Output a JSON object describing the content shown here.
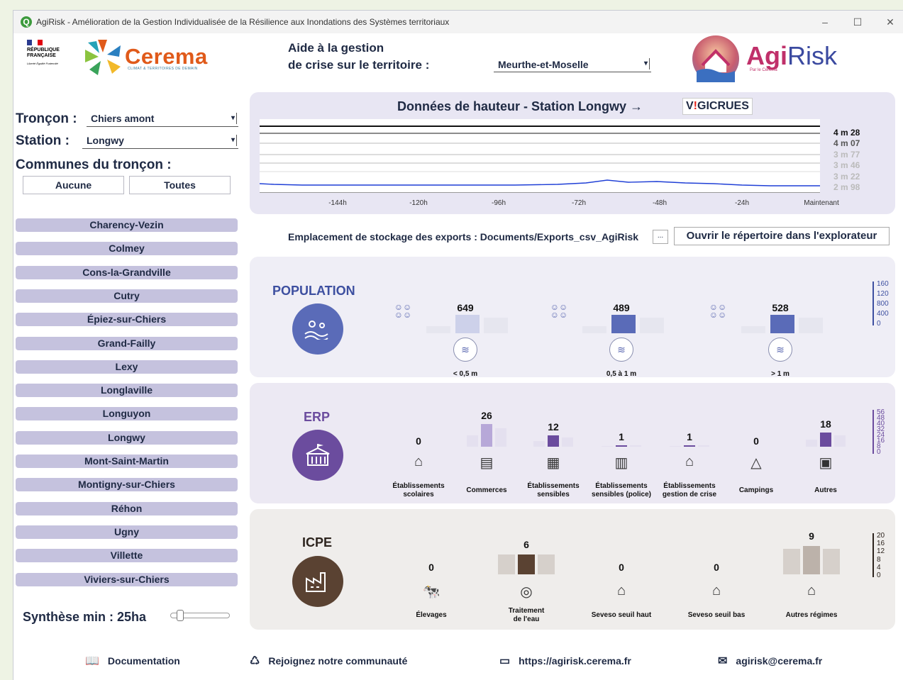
{
  "window": {
    "title": "AgiRisk - Amélioration de la Gestion Individualisée de la Résilience aux Inondations des Systèmes territoriaux",
    "minimize": "–",
    "maximize": "☐",
    "close": "✕"
  },
  "logos": {
    "rf": "RÉPUBLIQUE FRANÇAISE",
    "rf_motto": "Liberté Égalité Fraternité",
    "cerema": "Cerema",
    "cerema_sub": "CLIMAT & TERRITOIRES DE DEMAIN",
    "agirisk_a": "Agi",
    "agirisk_b": "Risk",
    "agirisk_sub": "Par le Cerema"
  },
  "header": {
    "aide_line1": "Aide à la gestion",
    "aide_line2": "de crise sur le territoire :",
    "departement": "Meurthe-et-Moselle"
  },
  "sidebar": {
    "troncon_label": "Tronçon :",
    "troncon_value": "Chiers amont",
    "station_label": "Station :",
    "station_value": "Longwy",
    "communes_label": "Communes du tronçon :",
    "btn_aucune": "Aucune",
    "btn_toutes": "Toutes",
    "communes": [
      "Charency-Vezin",
      "Colmey",
      "Cons-la-Grandville",
      "Cutry",
      "Épiez-sur-Chiers",
      "Grand-Failly",
      "Lexy",
      "Longlaville",
      "Longuyon",
      "Longwy",
      "Mont-Saint-Martin",
      "Montigny-sur-Chiers",
      "Réhon",
      "Ugny",
      "Villette",
      "Viviers-sur-Chiers"
    ],
    "synthese": "Synthèse min : 25ha"
  },
  "hydro": {
    "title": "Données de hauteur - Station Longwy →",
    "vigicrues_a": "V",
    "vigicrues_b": "!",
    "vigicrues_c": "GICRUES",
    "xticks": [
      "-144h",
      "-120h",
      "-96h",
      "-72h",
      "-48h",
      "-24h",
      "Maintenant"
    ],
    "levels": [
      "4 m 28",
      "4 m 07",
      "3 m 77",
      "3 m 46",
      "3 m 22",
      "2 m 98"
    ],
    "level_colors": [
      "#111111",
      "#555555",
      "#bbbbbb",
      "#bbbbbb",
      "#bbbbbb",
      "#bbbbbb"
    ],
    "series_color": "#1f3fd6"
  },
  "export": {
    "label": "Emplacement de stockage des exports : Documents/Exports_csv_AgiRisk",
    "dots": "...",
    "open_btn": "Ouvrir le répertoire dans l'explorateur"
  },
  "population": {
    "title": "POPULATION",
    "color": "#5a6bb8",
    "groups": [
      {
        "value": "649",
        "label": "< 0,5 m"
      },
      {
        "value": "489",
        "label": "0,5 à 1 m"
      },
      {
        "value": "528",
        "label": "> 1 m"
      }
    ],
    "scale": [
      "160",
      "120",
      "800",
      "400",
      "0"
    ]
  },
  "erp": {
    "title": "ERP",
    "color": "#6b4c9e",
    "items": [
      {
        "value": "0",
        "label1": "Établissements",
        "label2": "scolaires"
      },
      {
        "value": "26",
        "label1": "Commerces",
        "label2": ""
      },
      {
        "value": "12",
        "label1": "Établissements",
        "label2": "sensibles"
      },
      {
        "value": "1",
        "label1": "Établissements",
        "label2": "sensibles (police)"
      },
      {
        "value": "1",
        "label1": "Établissements",
        "label2": "gestion de crise"
      },
      {
        "value": "0",
        "label1": "Campings",
        "label2": ""
      },
      {
        "value": "18",
        "label1": "Autres",
        "label2": ""
      }
    ],
    "scale": [
      "56",
      "48",
      "40",
      "32",
      "24",
      "16",
      "8",
      "0"
    ]
  },
  "icpe": {
    "title": "ICPE",
    "color": "#5a4232",
    "items": [
      {
        "value": "0",
        "label1": "Élevages",
        "label2": ""
      },
      {
        "value": "6",
        "label1": "Traitement",
        "label2": "de l'eau"
      },
      {
        "value": "0",
        "label1": "Seveso seuil haut",
        "label2": ""
      },
      {
        "value": "0",
        "label1": "Seveso seuil bas",
        "label2": ""
      },
      {
        "value": "9",
        "label1": "Autres régimes",
        "label2": ""
      }
    ],
    "scale": [
      "20",
      "16",
      "12",
      "8",
      "4",
      "0"
    ]
  },
  "footer": {
    "doc": "Documentation",
    "community": "Rejoignez notre communauté",
    "site": "https://agirisk.cerema.fr",
    "email": "agirisk@cerema.fr"
  }
}
